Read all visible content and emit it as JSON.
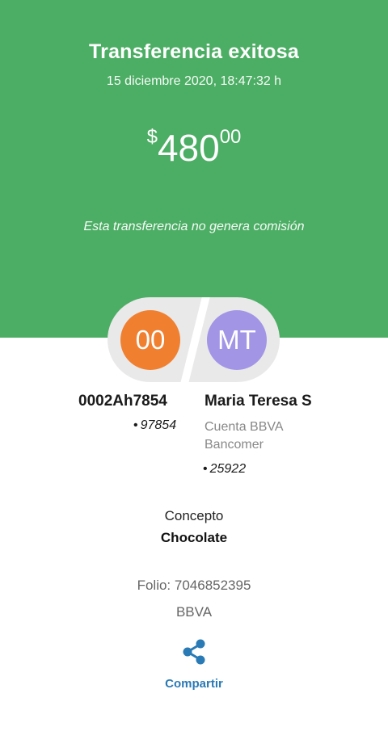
{
  "header": {
    "title": "Transferencia exitosa",
    "datetime": "15 diciembre 2020, 18:47:32 h",
    "amount_currency": "$",
    "amount_whole": "480",
    "amount_cents": "00",
    "notice": "Esta transferencia no genera comisión"
  },
  "sender": {
    "initials": "00",
    "account": "0002Ah7854",
    "number": "97854",
    "avatar_color": "#f07f30"
  },
  "recipient": {
    "initials": "MT",
    "name": "Maria Teresa S",
    "bank_line1": "Cuenta BBVA",
    "bank_line2": "Bancomer",
    "number": "25922",
    "avatar_color": "#a295e6"
  },
  "details": {
    "concepto_label": "Concepto",
    "concepto_value": "Chocolate",
    "folio": "Folio: 7046852395",
    "bank": "BBVA"
  },
  "share": {
    "icon": "share-icon",
    "label": "Compartir"
  },
  "colors": {
    "header_bg": "#4cae64",
    "accent": "#2a7ab5"
  }
}
